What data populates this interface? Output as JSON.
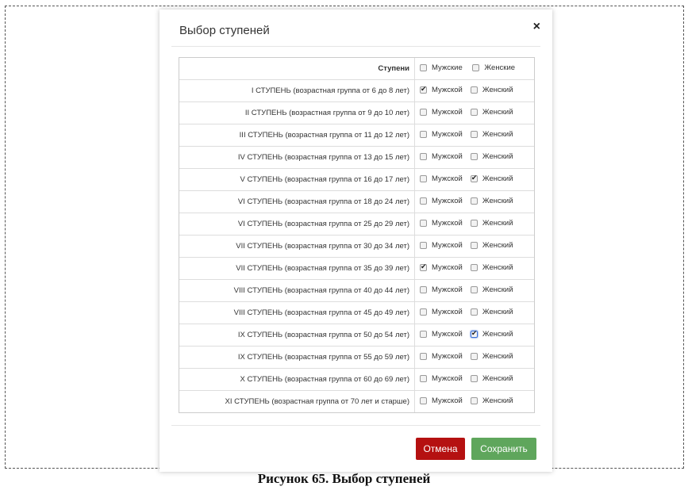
{
  "modal": {
    "title": "Выбор ступеней",
    "close_symbol": "×"
  },
  "table": {
    "header": {
      "label": "Ступени",
      "male": "Мужские",
      "female": "Женские",
      "male_checked": false,
      "female_checked": false
    },
    "rows": [
      {
        "label": "I СТУПЕНЬ (возрастная группа от 6 до 8 лет)",
        "male": "Мужской",
        "female": "Женский",
        "male_checked": true,
        "female_checked": false
      },
      {
        "label": "II СТУПЕНЬ (возрастная группа от 9 до 10 лет)",
        "male": "Мужской",
        "female": "Женский",
        "male_checked": false,
        "female_checked": false
      },
      {
        "label": "III СТУПЕНЬ (возрастная группа от 11 до 12 лет)",
        "male": "Мужской",
        "female": "Женский",
        "male_checked": false,
        "female_checked": false
      },
      {
        "label": "IV СТУПЕНЬ (возрастная группа от 13 до 15 лет)",
        "male": "Мужской",
        "female": "Женский",
        "male_checked": false,
        "female_checked": false
      },
      {
        "label": "V СТУПЕНЬ (возрастная группа от 16 до 17 лет)",
        "male": "Мужской",
        "female": "Женский",
        "male_checked": false,
        "female_checked": true
      },
      {
        "label": "VI СТУПЕНЬ (возрастная группа от 18 до 24 лет)",
        "male": "Мужской",
        "female": "Женский",
        "male_checked": false,
        "female_checked": false
      },
      {
        "label": "VI СТУПЕНЬ (возрастная группа от 25 до 29 лет)",
        "male": "Мужской",
        "female": "Женский",
        "male_checked": false,
        "female_checked": false
      },
      {
        "label": "VII СТУПЕНЬ (возрастная группа от 30 до 34 лет)",
        "male": "Мужской",
        "female": "Женский",
        "male_checked": false,
        "female_checked": false
      },
      {
        "label": "VII СТУПЕНЬ (возрастная группа от 35 до 39 лет)",
        "male": "Мужской",
        "female": "Женский",
        "male_checked": true,
        "female_checked": false
      },
      {
        "label": "VIII СТУПЕНЬ (возрастная группа от 40 до 44 лет)",
        "male": "Мужской",
        "female": "Женский",
        "male_checked": false,
        "female_checked": false
      },
      {
        "label": "VIII СТУПЕНЬ (возрастная группа от 45 до 49 лет)",
        "male": "Мужской",
        "female": "Женский",
        "male_checked": false,
        "female_checked": false
      },
      {
        "label": "IX СТУПЕНЬ (возрастная группа от 50 до 54 лет)",
        "male": "Мужской",
        "female": "Женский",
        "male_checked": false,
        "female_checked": true,
        "female_focused": true
      },
      {
        "label": "IX СТУПЕНЬ (возрастная группа от 55 до 59 лет)",
        "male": "Мужской",
        "female": "Женский",
        "male_checked": false,
        "female_checked": false
      },
      {
        "label": "X СТУПЕНЬ (возрастная группа от 60 до 69 лет)",
        "male": "Мужской",
        "female": "Женский",
        "male_checked": false,
        "female_checked": false
      },
      {
        "label": "XI СТУПЕНЬ (возрастная группа от 70 лет и старше)",
        "male": "Мужской",
        "female": "Женский",
        "male_checked": false,
        "female_checked": false
      }
    ]
  },
  "footer": {
    "cancel_label": "Отмена",
    "save_label": "Сохранить"
  },
  "colors": {
    "cancel": "#b51111",
    "save": "#5fa65c"
  },
  "caption": "Рисунок 65. Выбор ступеней"
}
